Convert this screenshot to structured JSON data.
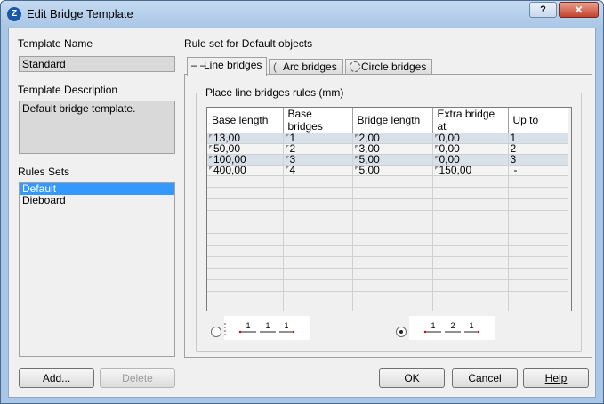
{
  "window": {
    "title": "Edit Bridge Template",
    "help_label": "?",
    "close_label": "✕"
  },
  "left": {
    "template_name_label": "Template Name",
    "template_name_value": "Standard",
    "template_description_label": "Template Description",
    "template_description_value": "Default bridge template.",
    "rules_sets_label": "Rules Sets",
    "rules_sets": [
      {
        "label": "Default",
        "selected": true
      },
      {
        "label": "Dieboard",
        "selected": false
      }
    ],
    "add_label": "Add...",
    "delete_label": "Delete"
  },
  "right": {
    "rule_set_label": "Rule set for Default objects",
    "tabs": [
      {
        "label": "Line bridges",
        "icon": "line-bridge-icon",
        "active": true
      },
      {
        "label": "Arc bridges",
        "icon": "arc-bridge-icon",
        "active": false
      },
      {
        "label": "Circle bridges",
        "icon": "circle-bridge-icon",
        "active": false
      }
    ],
    "group_title": "Place line bridges rules (mm)",
    "columns": [
      "Base length",
      "Base bridges",
      "Bridge length",
      "Extra bridge at",
      "Up to"
    ],
    "rows": [
      [
        "13,00",
        "1",
        "2,00",
        "0,00",
        "1"
      ],
      [
        "50,00",
        "2",
        "3,00",
        "0,00",
        "2"
      ],
      [
        "100,00",
        "3",
        "5,00",
        "0,00",
        "3"
      ],
      [
        "400,00",
        "4",
        "5,00",
        "150,00",
        "-"
      ]
    ],
    "option_a": {
      "labels": [
        "1",
        "1",
        "1"
      ],
      "selected": false
    },
    "option_b": {
      "labels": [
        "1",
        "2",
        "1"
      ],
      "selected": true
    }
  },
  "buttons": {
    "ok_label": "OK",
    "cancel_label": "Cancel",
    "help_label": "Help"
  }
}
